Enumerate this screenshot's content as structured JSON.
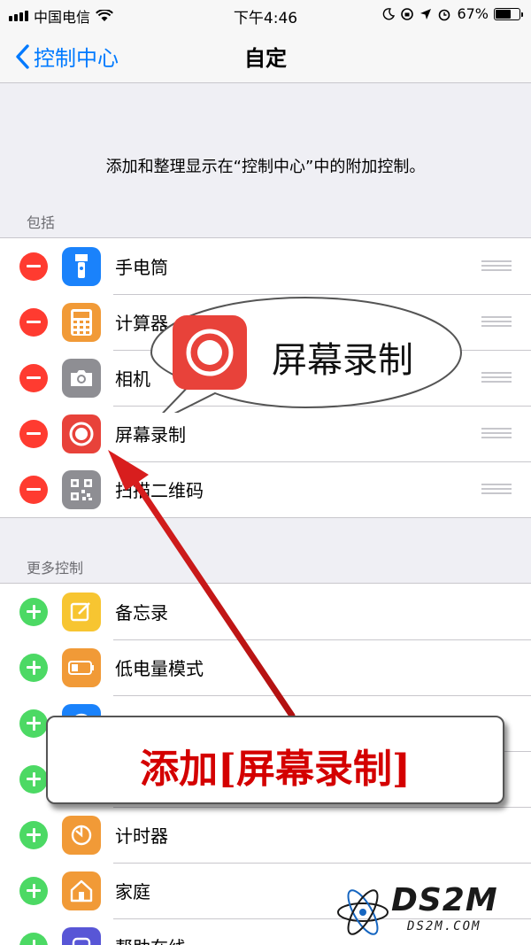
{
  "status_bar": {
    "carrier": "中国电信",
    "time": "下午4:46",
    "battery_percent": "67%",
    "battery_level": 0.67
  },
  "nav": {
    "back_label": "控制中心",
    "title": "自定"
  },
  "description": "添加和整理显示在“控制中心”中的附加控制。",
  "included": {
    "header": "包括",
    "items": [
      {
        "label": "手电筒",
        "icon": "flashlight-icon",
        "color": "#1a82fb"
      },
      {
        "label": "计算器",
        "icon": "calculator-icon",
        "color": "#f19a37"
      },
      {
        "label": "相机",
        "icon": "camera-icon",
        "color": "#8e8e93"
      },
      {
        "label": "屏幕录制",
        "icon": "screen-record-icon",
        "color": "#e8423a"
      },
      {
        "label": "扫描二维码",
        "icon": "qr-code-icon",
        "color": "#8e8e93"
      }
    ]
  },
  "more": {
    "header": "更多控制",
    "items": [
      {
        "label": "备忘录",
        "icon": "notes-icon",
        "color": "#f7c531"
      },
      {
        "label": "低电量模式",
        "icon": "low-power-icon",
        "color": "#f19a37"
      },
      {
        "label": "",
        "icon": "hidden-icon",
        "color": "#1a82fb"
      },
      {
        "label": "",
        "icon": "hidden-icon",
        "color": "#ffffff"
      },
      {
        "label": "计时器",
        "icon": "timer-icon",
        "color": "#f19a37"
      },
      {
        "label": "家庭",
        "icon": "home-icon",
        "color": "#f19a37"
      },
      {
        "label": "帮助在线",
        "icon": "accessibility-icon",
        "color": "#5856d6"
      }
    ]
  },
  "callout": {
    "label": "屏幕录制"
  },
  "banner": {
    "text": "添加[屏幕录制]"
  },
  "watermark": {
    "main": "DS2M",
    "sub": "DS2M.COM"
  },
  "colors": {
    "ios_blue": "#007aff",
    "remove_red": "#ff3b30",
    "add_green": "#4cd964",
    "banner_red": "#d40000",
    "arrow_red": "#d81e1e"
  }
}
